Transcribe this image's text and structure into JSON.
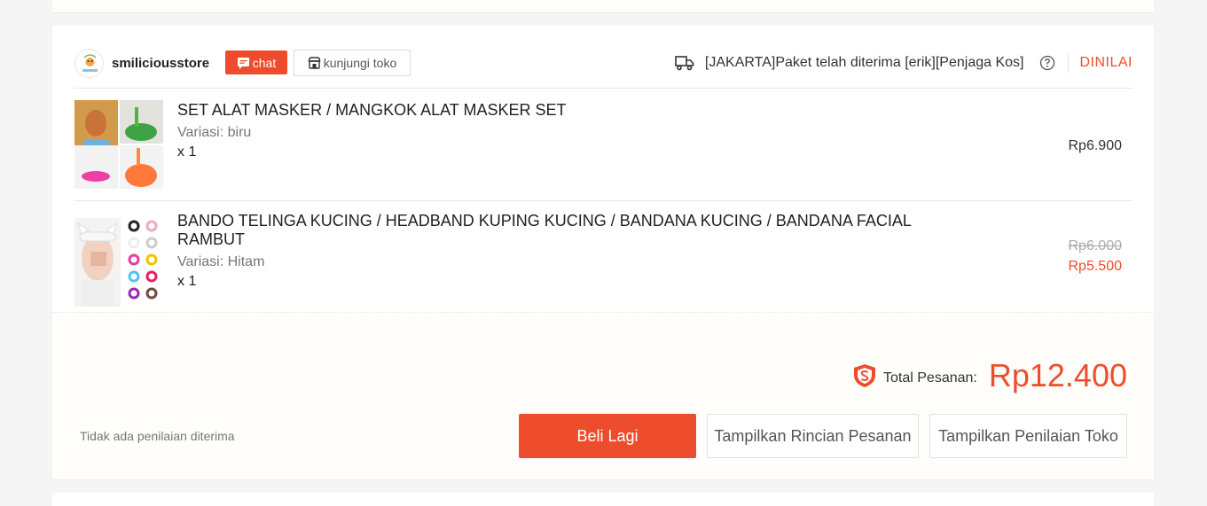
{
  "shop": {
    "name": "smiliciousstore",
    "chat_label": "chat",
    "visit_label": "kunjungi toko",
    "shipping_status": "[JAKARTA]Paket telah diterima [erik][Penjaga Kos]",
    "order_status": "DINILAI"
  },
  "products": [
    {
      "name": "SET ALAT MASKER / MANGKOK ALAT MASKER SET",
      "variant": "Variasi: biru",
      "qty": "x 1",
      "price": "Rp6.900"
    },
    {
      "name": "BANDO TELINGA KUCING / HEADBAND KUPING KUCING / BANDANA KUCING / BANDANA FACIAL RAMBUT",
      "variant": "Variasi: Hitam",
      "qty": "x 1",
      "price_original": "Rp6.000",
      "price": "Rp5.500"
    }
  ],
  "footer": {
    "total_label": "Total Pesanan:",
    "total_value": "Rp12.400",
    "review_note": "Tidak ada penilaian diterima",
    "buy_again": "Beli Lagi",
    "view_details": "Tampilkan Rincian Pesanan",
    "view_rating": "Tampilkan Penilaian Toko"
  },
  "colors": {
    "accent": "#ee4d2d"
  },
  "icons": [
    "chat-icon",
    "shop-icon",
    "truck-icon",
    "help-icon",
    "shield-icon"
  ]
}
